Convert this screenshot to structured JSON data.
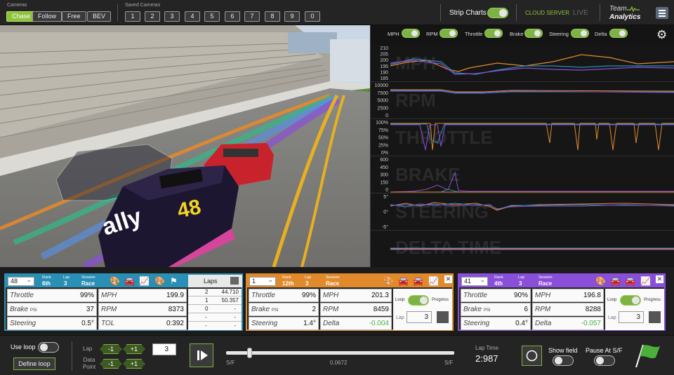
{
  "topbar": {
    "cameras_label": "Cameras",
    "camera_buttons": [
      "Chase",
      "Follow",
      "Free",
      "BEV"
    ],
    "saved_cameras_label": "Saved Cameras",
    "saved_buttons": [
      "1",
      "2",
      "3",
      "4",
      "5",
      "6",
      "7",
      "8",
      "9",
      "0"
    ],
    "strip_charts_label": "Strip Charts",
    "cloud_server": "CLOUD SERVER",
    "live": "LIVE",
    "brand_line1": "Team",
    "brand_line2": "Analytics"
  },
  "chart_toggles": [
    "MPH",
    "RPM",
    "Throttle",
    "Brake",
    "Steering",
    "Delta"
  ],
  "chart_data": {
    "type": "line",
    "strips": [
      {
        "name": "MPH",
        "ticks": [
          "210",
          "205",
          "200",
          "195",
          "190",
          "185"
        ]
      },
      {
        "name": "RPM",
        "ticks": [
          "10000",
          "7500",
          "5000",
          "2500",
          "0"
        ]
      },
      {
        "name": "THROTTLE",
        "ticks": [
          "100%",
          "75%",
          "50%",
          "25%",
          "0%"
        ]
      },
      {
        "name": "BRAKE",
        "ticks": [
          "600",
          "450",
          "300",
          "150",
          "0"
        ]
      },
      {
        "name": "STEERING",
        "ticks": [
          "5°",
          "0°",
          "-5°"
        ]
      },
      {
        "name": "DELTA TIME",
        "ticks": []
      }
    ]
  },
  "panels": [
    {
      "color": "#2a8fb5",
      "car": "48",
      "rank_label": "Rank",
      "rank": "6th",
      "lap_label": "Lap",
      "lap": "3",
      "session_label": "Session",
      "session": "Race",
      "left": [
        {
          "k": "Throttle",
          "unit": "",
          "v": "99%"
        },
        {
          "k": "Brake",
          "unit": "PSI",
          "v": "37"
        },
        {
          "k": "Steering",
          "unit": "",
          "v": "0.5°"
        }
      ],
      "right": [
        {
          "k": "MPH",
          "v": "199.9"
        },
        {
          "k": "RPM",
          "v": "8373"
        },
        {
          "k": "TOL",
          "v": "0:392"
        }
      ],
      "laps_title": "Laps",
      "laps": [
        [
          "2",
          "44.710"
        ],
        [
          "1",
          "50.357"
        ],
        [
          "0",
          "-"
        ],
        [
          "-",
          "-"
        ],
        [
          "-",
          "-"
        ]
      ]
    },
    {
      "color": "#e08a2c",
      "car": "1",
      "rank_label": "Rank",
      "rank": "12th",
      "lap_label": "Lap",
      "lap": "3",
      "session_label": "Session",
      "session": "Race",
      "left": [
        {
          "k": "Throttle",
          "unit": "",
          "v": "99%"
        },
        {
          "k": "Brake",
          "unit": "PSI",
          "v": "2"
        },
        {
          "k": "Steering",
          "unit": "",
          "v": "1.4°"
        }
      ],
      "right": [
        {
          "k": "MPH",
          "v": "201.3"
        },
        {
          "k": "RPM",
          "v": "8459"
        },
        {
          "k": "Delta",
          "v": "-0.004"
        }
      ],
      "loop_label": "Loop",
      "progress_label": "Progress",
      "lap_box_label": "Lap",
      "lap_box_value": "3"
    },
    {
      "color": "#8a4fd8",
      "car": "41",
      "rank_label": "Rank",
      "rank": "4th",
      "lap_label": "Lap",
      "lap": "3",
      "session_label": "Session",
      "session": "Race",
      "left": [
        {
          "k": "Throttle",
          "unit": "",
          "v": "90%"
        },
        {
          "k": "Brake",
          "unit": "PSI",
          "v": "6"
        },
        {
          "k": "Steering",
          "unit": "",
          "v": "0.4°"
        }
      ],
      "right": [
        {
          "k": "MPH",
          "v": "196.8"
        },
        {
          "k": "RPM",
          "v": "8288"
        },
        {
          "k": "Delta",
          "v": "-0.057"
        }
      ],
      "loop_label": "Loop",
      "progress_label": "Progress",
      "lap_box_label": "Lap",
      "lap_box_value": "3"
    }
  ],
  "bottom": {
    "use_loop": "Use loop",
    "define_loop": "Define loop",
    "lap_label": "Lap",
    "data_point_label": "Data Point",
    "minus": "-1",
    "plus": "+1",
    "lap_value": "3",
    "sf_left": "S/F",
    "sf_right": "S/F",
    "progress_value": "0.0672",
    "progress": 0.03,
    "lap_time_label": "Lap Time",
    "lap_time": "2:987",
    "show_field": "Show field",
    "pause_sf": "Pause At S/F"
  },
  "colors": {
    "accent": "#7cb342",
    "car_blue": "#2a8fb5",
    "car_orange": "#e08a2c",
    "car_purple": "#8a4fd8"
  }
}
